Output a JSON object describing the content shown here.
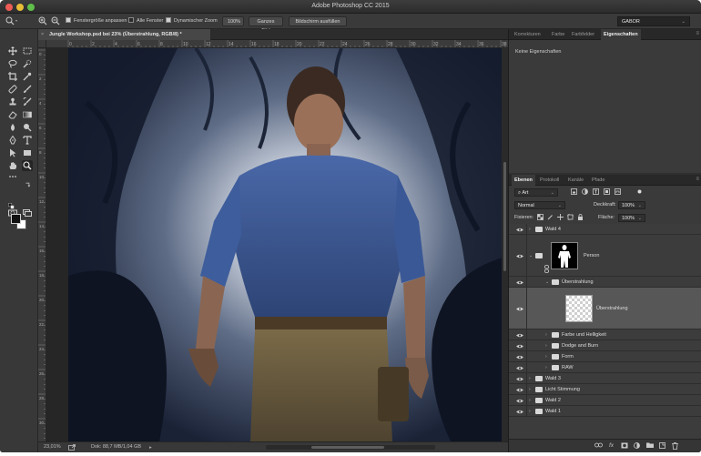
{
  "app": {
    "title": "Adobe Photoshop CC 2015"
  },
  "options_bar": {
    "fit_window": "Fenstergröße anpassen",
    "all_windows": "Alle Fenster",
    "scrubby_zoom": "Dynamischer Zoom",
    "zoom_value": "100%",
    "fit_screen": "Ganzes Bild",
    "fill_screen": "Bildschirm ausfüllen",
    "workspace": "GABOR"
  },
  "document": {
    "tab_title": "Jungle Workshop.psd bei 23% (Überstrahlung, RGB/8) *",
    "close": "×"
  },
  "rulers": {
    "horizontal": [
      "0",
      "2",
      "4",
      "6",
      "8",
      "10",
      "12",
      "14",
      "16",
      "18",
      "20",
      "22",
      "24",
      "26",
      "28",
      "30",
      "32",
      "34",
      "36",
      "38"
    ],
    "vertical": [
      "0",
      "2",
      "4",
      "6",
      "8",
      "10",
      "12",
      "14",
      "16",
      "18",
      "20",
      "22",
      "24",
      "26",
      "28",
      "30"
    ]
  },
  "status_bar": {
    "zoom": "23,01%",
    "doc_size": "Dok: 88,7 MB/1,04 GB"
  },
  "properties_panel": {
    "tabs": [
      "Korrekturen",
      "Farbe",
      "Farbfelder",
      "Eigenschaften"
    ],
    "active_tab": 3,
    "empty_text": "Keine Eigenschaften"
  },
  "layers_panel": {
    "tabs": [
      "Ebenen",
      "Protokoll",
      "Kanäle",
      "Pfade"
    ],
    "active_tab": 0,
    "filter_kind": "Art",
    "blend_mode": "Normal",
    "opacity_label": "Deckkraft:",
    "opacity_value": "100%",
    "lock_label": "Fixieren:",
    "fill_label": "Fläche:",
    "fill_value": "100%",
    "layers": [
      {
        "name": "Wald 4",
        "type": "group",
        "indent": 0,
        "expanded": false
      },
      {
        "name": "Person",
        "type": "group-mask",
        "indent": 0,
        "expanded": true
      },
      {
        "name": "Überstrahlung",
        "type": "group",
        "indent": 1,
        "expanded": true
      },
      {
        "name": "Überstrahlung",
        "type": "layer",
        "indent": 2,
        "selected": true
      },
      {
        "name": "Farbe und Helligkeit",
        "type": "group",
        "indent": 1,
        "expanded": false
      },
      {
        "name": "Dodge and Burn",
        "type": "group",
        "indent": 1,
        "expanded": false
      },
      {
        "name": "Form",
        "type": "group",
        "indent": 1,
        "expanded": false
      },
      {
        "name": "RAW",
        "type": "group",
        "indent": 1,
        "expanded": false
      },
      {
        "name": "Wald 3",
        "type": "group",
        "indent": 0,
        "expanded": false
      },
      {
        "name": "Licht Stimmung",
        "type": "group",
        "indent": 0,
        "expanded": false
      },
      {
        "name": "Wald 2",
        "type": "group",
        "indent": 0,
        "expanded": false
      },
      {
        "name": "Wald 1",
        "type": "group",
        "indent": 0,
        "expanded": false
      }
    ],
    "footer_icons": [
      "link-icon",
      "fx-icon",
      "mask-icon",
      "adjustment-icon",
      "group-icon",
      "new-layer-icon",
      "trash-icon"
    ],
    "footer_fx": "fx"
  },
  "colors": {
    "chrome": "#2f2f2f",
    "panel": "#3a3a3a",
    "selected_layer": "#575757",
    "shirt": "#3b5a9a",
    "pants": "#6a5a3c"
  }
}
